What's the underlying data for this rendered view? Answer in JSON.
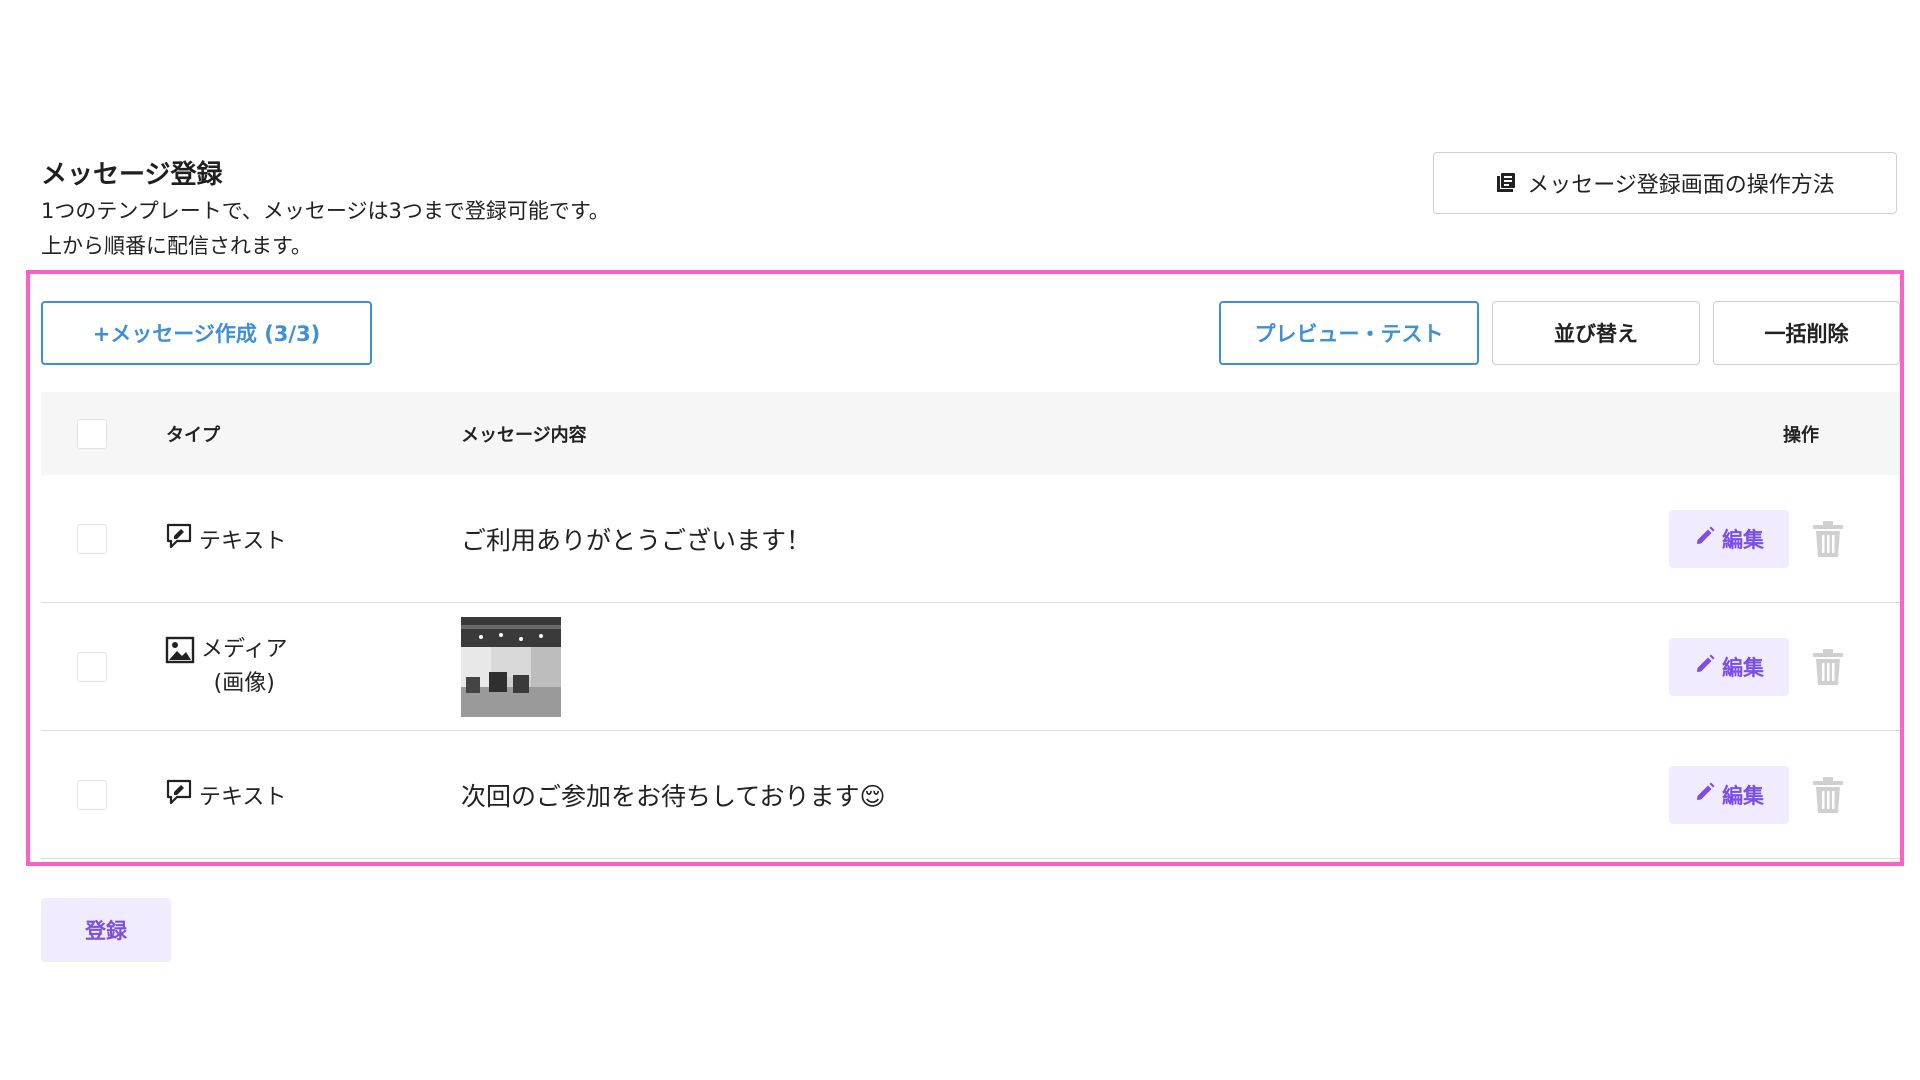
{
  "header": {
    "title": "メッセージ登録",
    "description_line1": "1つのテンプレートで、メッセージは3つまで登録可能です。",
    "description_line2": "上から順番に配信されます。",
    "help_button_label": "メッセージ登録画面の操作方法",
    "help_icon": "book-icon"
  },
  "toolbar": {
    "create_label": "+メッセージ作成 (3/3)",
    "preview_label": "プレビュー・テスト",
    "sort_label": "並び替え",
    "bulk_delete_label": "一括削除"
  },
  "table": {
    "columns": {
      "type": "タイプ",
      "content": "メッセージ内容",
      "operations": "操作"
    },
    "rows": [
      {
        "type_icon": "chat-text-icon",
        "type_label": "テキスト",
        "type_sub": "",
        "content": "ご利用ありがとうございます！",
        "content_kind": "text",
        "edit_label": "編集"
      },
      {
        "type_icon": "image-icon",
        "type_label": "メディア",
        "type_sub": "(画像)",
        "content": "",
        "content_kind": "image",
        "edit_label": "編集"
      },
      {
        "type_icon": "chat-text-icon",
        "type_label": "テキスト",
        "type_sub": "",
        "content": "次回のご参加をお待ちしております😌",
        "content_kind": "text",
        "edit_label": "編集"
      }
    ]
  },
  "footer": {
    "submit_label": "登録"
  },
  "colors": {
    "accent_blue": "#3d8fd6",
    "accent_purple": "#7b4fe0",
    "purple_bg": "#f1ebff",
    "highlight_pink": "#ff5fc8",
    "trash_gray": "#d0d0d0"
  }
}
